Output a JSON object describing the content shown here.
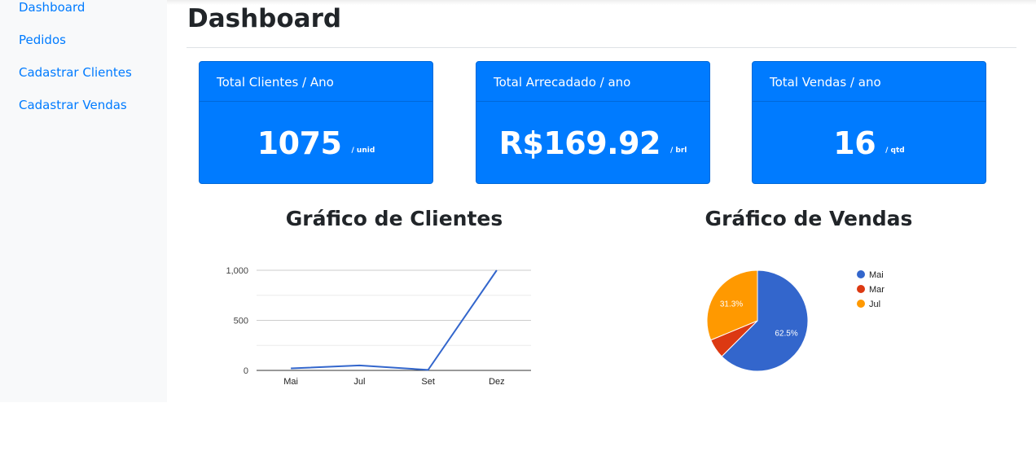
{
  "sidebar": {
    "items": [
      {
        "label": "Dashboard"
      },
      {
        "label": "Pedidos"
      },
      {
        "label": "Cadastrar Clientes"
      },
      {
        "label": "Cadastrar Vendas"
      }
    ]
  },
  "header": {
    "title": "Dashboard"
  },
  "cards": [
    {
      "title": "Total Clientes / Ano",
      "value": "1075",
      "unit": "/ unid"
    },
    {
      "title": "Total Arrecadado / ano",
      "value": "R$169.92",
      "unit": "/ brl"
    },
    {
      "title": "Total Vendas / ano",
      "value": "16",
      "unit": "/ qtd"
    }
  ],
  "colors": {
    "primary": "#007bff",
    "series_blue": "#3366cc",
    "series_red": "#dc3912",
    "series_orange": "#ff9900"
  },
  "chart_data": [
    {
      "type": "line",
      "title": "Gráfico de Clientes",
      "categories": [
        "Mai",
        "Jul",
        "Set",
        "Dez"
      ],
      "series": [
        {
          "values": [
            20,
            50,
            5,
            1000
          ]
        }
      ],
      "yticks": [
        "1,000",
        "500",
        "0"
      ],
      "ylim": [
        0,
        1000
      ],
      "grid": true
    },
    {
      "type": "pie",
      "title": "Gráfico de Vendas",
      "labels": [
        "Mai",
        "Mar",
        "Jul"
      ],
      "values": [
        62.5,
        6.25,
        31.25
      ],
      "data_labels": [
        "62.5%",
        "",
        "31.3%"
      ],
      "legend": "right"
    }
  ]
}
